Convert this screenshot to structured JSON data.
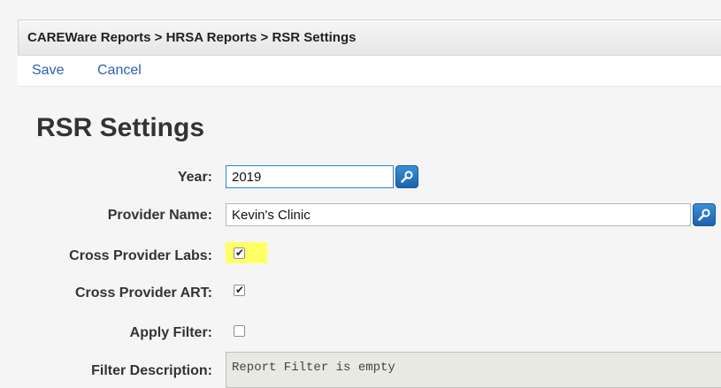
{
  "breadcrumb": {
    "text": "CAREWare Reports > HRSA Reports > RSR Settings"
  },
  "toolbar": {
    "save_label": "Save",
    "cancel_label": "Cancel"
  },
  "page": {
    "title": "RSR Settings"
  },
  "form": {
    "year": {
      "label": "Year:",
      "value": "2019"
    },
    "provider_name": {
      "label": "Provider Name:",
      "value": "Kevin's Clinic"
    },
    "cross_provider_labs": {
      "label": "Cross Provider Labs:",
      "checked": true,
      "highlight_color": "#ffff66"
    },
    "cross_provider_art": {
      "label": "Cross Provider ART:",
      "checked": true
    },
    "apply_filter": {
      "label": "Apply Filter:",
      "checked": false
    },
    "filter_description": {
      "label": "Filter Description:",
      "value": "Report Filter is empty"
    }
  },
  "icons": {
    "lookup": "magnifier-lookup-icon",
    "check": "check-icon"
  },
  "colors": {
    "link": "#2a62b3",
    "lookup_button": "#1b62ac",
    "focus_border": "#2b86d0"
  }
}
